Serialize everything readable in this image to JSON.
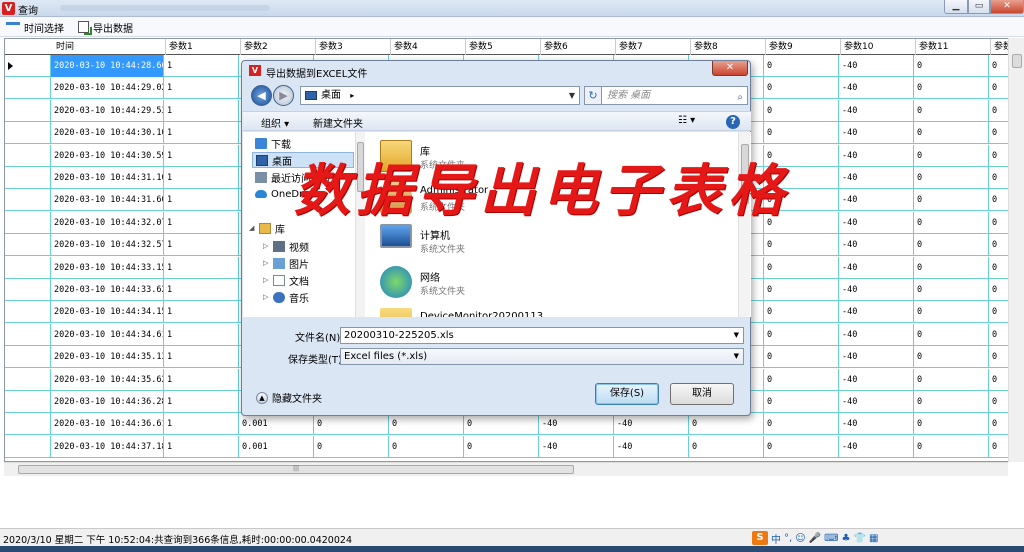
{
  "window": {
    "title": "查询",
    "min": "▁",
    "max": "▭",
    "close": "✕"
  },
  "toolbar": {
    "time_select": "时间选择",
    "export": "导出数据"
  },
  "grid": {
    "columns": [
      "时间",
      "参数1",
      "参数2",
      "参数3",
      "参数4",
      "参数5",
      "参数6",
      "参数7",
      "参数8",
      "参数9",
      "参数10",
      "参数11",
      "参数"
    ],
    "rows": [
      [
        "2020-03-10 10:44:28.660",
        "1",
        "",
        "",
        "",
        "",
        "",
        "",
        "",
        "0",
        "-40",
        "0",
        "0"
      ],
      [
        "2020-03-10 10:44:29.028",
        "1",
        "",
        "",
        "",
        "",
        "",
        "",
        "",
        "0",
        "-40",
        "0",
        "0"
      ],
      [
        "2020-03-10 10:44:29.534",
        "1",
        "",
        "",
        "",
        "",
        "",
        "",
        "",
        "0",
        "-40",
        "0",
        "0"
      ],
      [
        "2020-03-10 10:44:30.102",
        "1",
        "",
        "",
        "",
        "",
        "",
        "",
        "",
        "0",
        "-40",
        "0",
        "0"
      ],
      [
        "2020-03-10 10:44:30.590",
        "1",
        "",
        "",
        "",
        "",
        "",
        "",
        "",
        "0",
        "-40",
        "0",
        "0"
      ],
      [
        "2020-03-10 10:44:31.107",
        "1",
        "",
        "",
        "",
        "",
        "",
        "",
        "",
        "0",
        "-40",
        "0",
        "0"
      ],
      [
        "2020-03-10 10:44:31.600",
        "1",
        "",
        "",
        "",
        "",
        "",
        "",
        "",
        "0",
        "-40",
        "0",
        "0"
      ],
      [
        "2020-03-10 10:44:32.076",
        "1",
        "",
        "",
        "",
        "",
        "",
        "",
        "",
        "0",
        "-40",
        "0",
        "0"
      ],
      [
        "2020-03-10 10:44:32.576",
        "1",
        "",
        "",
        "",
        "",
        "",
        "",
        "",
        "0",
        "-40",
        "0",
        "0"
      ],
      [
        "2020-03-10 10:44:33.150",
        "1",
        "",
        "",
        "",
        "",
        "",
        "",
        "",
        "0",
        "-40",
        "0",
        "0"
      ],
      [
        "2020-03-10 10:44:33.628",
        "1",
        "",
        "",
        "",
        "",
        "",
        "",
        "",
        "0",
        "-40",
        "0",
        "0"
      ],
      [
        "2020-03-10 10:44:34.150",
        "1",
        "",
        "",
        "",
        "",
        "",
        "",
        "",
        "0",
        "-40",
        "0",
        "0"
      ],
      [
        "2020-03-10 10:44:34.618",
        "1",
        "",
        "",
        "",
        "",
        "",
        "",
        "",
        "0",
        "-40",
        "0",
        "0"
      ],
      [
        "2020-03-10 10:44:35.138",
        "1",
        "",
        "",
        "",
        "",
        "",
        "",
        "",
        "0",
        "-40",
        "0",
        "0"
      ],
      [
        "2020-03-10 10:44:35.628",
        "1",
        "",
        "",
        "",
        "",
        "",
        "",
        "",
        "0",
        "-40",
        "0",
        "0"
      ],
      [
        "2020-03-10 10:44:36.284",
        "1",
        "",
        "",
        "",
        "",
        "",
        "",
        "",
        "0",
        "-40",
        "0",
        "0"
      ],
      [
        "2020-03-10 10:44:36.612",
        "1",
        "0.001",
        "0",
        "0",
        "0",
        "-40",
        "-40",
        "0",
        "0",
        "-40",
        "0",
        "0"
      ],
      [
        "2020-03-10 10:44:37.183",
        "1",
        "0.001",
        "0",
        "0",
        "0",
        "-40",
        "-40",
        "0",
        "0",
        "-40",
        "0",
        "0"
      ]
    ]
  },
  "dialog": {
    "title": "导出数据到EXCEL文件",
    "address": "桌面",
    "search_placeholder": "搜索 桌面",
    "organize": "组织 ▾",
    "new_folder": "新建文件夹",
    "view_glyph": "☷ ▾",
    "help_glyph": "?",
    "nav_items": [
      {
        "label": "下载",
        "icon": "download-folder-icon"
      },
      {
        "label": "桌面",
        "icon": "desktop-icon"
      },
      {
        "label": "最近访问的位置",
        "icon": "recent-places-icon"
      },
      {
        "label": "OneDrive",
        "icon": "onedrive-icon"
      },
      {
        "label": "库",
        "icon": "library-icon"
      },
      {
        "label": "视频",
        "icon": "videos-icon"
      },
      {
        "label": "图片",
        "icon": "pictures-icon"
      },
      {
        "label": "文档",
        "icon": "documents-icon"
      },
      {
        "label": "音乐",
        "icon": "music-icon"
      }
    ],
    "files": [
      {
        "name": "库",
        "type": "系统文件夹",
        "icon": "library-icon"
      },
      {
        "name": "Administrator",
        "type": "系统文件夹",
        "icon": "user-folder-icon"
      },
      {
        "name": "计算机",
        "type": "系统文件夹",
        "icon": "computer-icon"
      },
      {
        "name": "网络",
        "type": "系统文件夹",
        "icon": "network-icon"
      },
      {
        "name": "DeviceMonitor20200113",
        "type": "",
        "icon": "folder-icon"
      }
    ],
    "filename_label": "文件名(N):",
    "filename_value": "20200310-225205.xls",
    "filetype_label": "保存类型(T):",
    "filetype_value": "Excel files (*.xls)",
    "hide_folders": "隐藏文件夹",
    "save": "保存(S)",
    "cancel": "取消"
  },
  "statusbar": {
    "text": "2020/3/10 星期二 下午 10:52:04:共查询到366条信息,耗时:00:00:00.0420024"
  },
  "ime": {
    "logo": "S",
    "items": [
      "中",
      "°,",
      "☺",
      "🎤",
      "⌨",
      "♣",
      "👕",
      "▦"
    ]
  },
  "overlay_caption": "数据导出电子表格"
}
